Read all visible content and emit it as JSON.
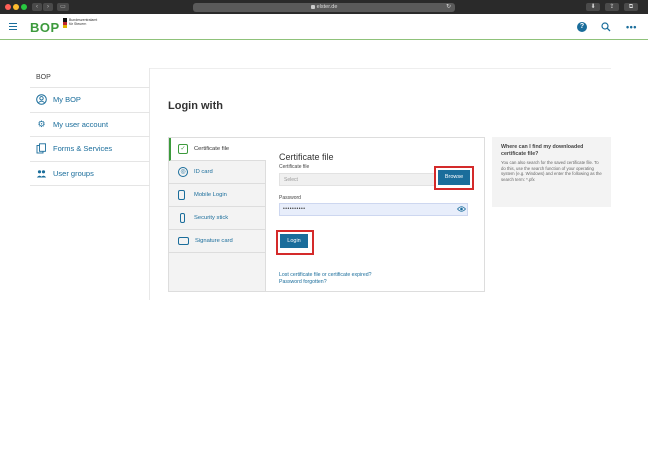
{
  "browser": {
    "url": "elster.de"
  },
  "header": {
    "brand": "BOP",
    "ministry": "Bundeszentralamt für Steuern",
    "help_icon": "?",
    "search_icon": "search",
    "more_icon": "more-horizontal",
    "accent_color": "#3c9a3c",
    "link_color": "#1a6d9b"
  },
  "sidebar": {
    "title": "BOP",
    "items": [
      {
        "label": "My BOP",
        "icon": "user-circle-icon"
      },
      {
        "label": "My user account",
        "icon": "gear-icon"
      },
      {
        "label": "Forms & Services",
        "icon": "documents-icon"
      },
      {
        "label": "User groups",
        "icon": "users-icon"
      }
    ]
  },
  "main": {
    "title": "Login with",
    "methods": [
      {
        "label": "Certificate file",
        "icon": "certificate-icon",
        "active": true
      },
      {
        "label": "ID card",
        "icon": "id-card-icon",
        "active": false
      },
      {
        "label": "Mobile Login",
        "icon": "mobile-icon",
        "active": false
      },
      {
        "label": "Security stick",
        "icon": "usb-stick-icon",
        "active": false
      },
      {
        "label": "Signature card",
        "icon": "signature-card-icon",
        "active": false
      }
    ],
    "form": {
      "title": "Certificate file",
      "file_label": "Certificate file",
      "file_placeholder": "Select",
      "browse_label": "Browse",
      "password_label": "Password",
      "password_value": "••••••••••",
      "login_label": "Login",
      "lost_link": "Lost certificate file or certificate expired?",
      "forgot_link": "Password forgotten?"
    }
  },
  "help": {
    "title": "Where can I find my downloaded certificate file?",
    "text": "You can also search for the saved certificate file. To do this, use the search function of your operating system (e.g. Windows) and enter the following as the search term: *.pfx"
  }
}
